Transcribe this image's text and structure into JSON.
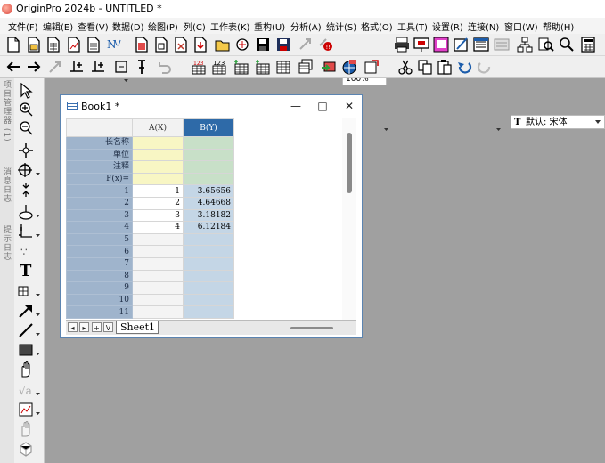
{
  "app": {
    "title": "OriginPro 2024b - UNTITLED *"
  },
  "menu": [
    "文件(F)",
    "编辑(E)",
    "查看(V)",
    "数据(D)",
    "绘图(P)",
    "列(C)",
    "工作表(K)",
    "重构(U)",
    "分析(A)",
    "统计(S)",
    "格式(O)",
    "工具(T)",
    "设置(R)",
    "连接(N)",
    "窗口(W)",
    "帮助(H)"
  ],
  "toolbar": {
    "zoom": "100%",
    "font": "默认: 宋体",
    "font_icon": "T"
  },
  "left_tabs": [
    "项目管理器 (1)",
    "消息日志",
    "提示日志"
  ],
  "workbook": {
    "title": "Book1 *",
    "minimize": "—",
    "maximize": "□",
    "close": "✕",
    "columns": [
      "A(X)",
      "B(Y)"
    ],
    "meta_rows": [
      "长名称",
      "单位",
      "注释",
      "F(x)="
    ],
    "rows": [
      {
        "n": "1",
        "a": "1",
        "b": "3.65656"
      },
      {
        "n": "2",
        "a": "2",
        "b": "4.64668"
      },
      {
        "n": "3",
        "a": "3",
        "b": "3.18182"
      },
      {
        "n": "4",
        "a": "4",
        "b": "6.12184"
      },
      {
        "n": "5",
        "a": "",
        "b": ""
      },
      {
        "n": "6",
        "a": "",
        "b": ""
      },
      {
        "n": "7",
        "a": "",
        "b": ""
      },
      {
        "n": "8",
        "a": "",
        "b": ""
      },
      {
        "n": "9",
        "a": "",
        "b": ""
      },
      {
        "n": "10",
        "a": "",
        "b": ""
      },
      {
        "n": "11",
        "a": "",
        "b": ""
      }
    ],
    "nav": [
      "◂",
      "▸",
      "+",
      "V"
    ],
    "sheet_tab": "Sheet1"
  }
}
